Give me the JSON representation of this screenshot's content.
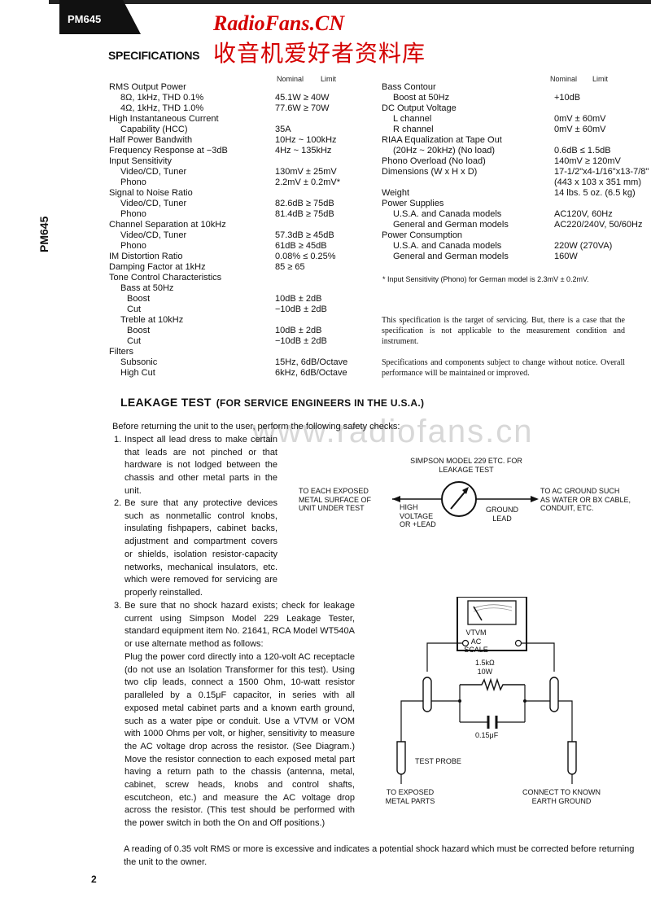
{
  "header": {
    "model_tab": "PM645",
    "watermark_en": "RadioFans.CN",
    "watermark_cn": "收音机爱好者资料库",
    "watermark_url": "www.radiofans.cn",
    "side_label": "PM645",
    "page_number": "2"
  },
  "specifications": {
    "title": "SPECIFICATIONS",
    "col_nominal": "Nominal",
    "col_limit": "Limit",
    "left_rows": [
      {
        "label": "RMS Output Power",
        "indent": 0,
        "value": ""
      },
      {
        "label": "8Ω, 1kHz, THD 0.1%",
        "indent": 1,
        "value": "45.1W ≥ 40W"
      },
      {
        "label": "4Ω, 1kHz, THD 1.0%",
        "indent": 1,
        "value": "77.6W ≥ 70W"
      },
      {
        "label": "High Instantaneous Current",
        "indent": 0,
        "value": ""
      },
      {
        "label": "Capability (HCC)",
        "indent": 1,
        "value": "35A"
      },
      {
        "label": "Half Power Bandwith",
        "indent": 0,
        "value": "10Hz ~ 100kHz"
      },
      {
        "label": "Frequency Response at −3dB",
        "indent": 0,
        "value": "4Hz ~ 135kHz"
      },
      {
        "label": "Input Sensitivity",
        "indent": 0,
        "value": ""
      },
      {
        "label": "Video/CD, Tuner",
        "indent": 1,
        "value": "130mV ± 25mV"
      },
      {
        "label": "Phono",
        "indent": 1,
        "value": "2.2mV ± 0.2mV*"
      },
      {
        "label": "Signal to Noise Ratio",
        "indent": 0,
        "value": ""
      },
      {
        "label": "Video/CD, Tuner",
        "indent": 1,
        "value": "82.6dB ≥ 75dB"
      },
      {
        "label": "Phono",
        "indent": 1,
        "value": "81.4dB ≥ 75dB"
      },
      {
        "label": "Channel Separation at 10kHz",
        "indent": 0,
        "value": ""
      },
      {
        "label": "Video/CD, Tuner",
        "indent": 1,
        "value": "57.3dB ≥ 45dB"
      },
      {
        "label": "Phono",
        "indent": 1,
        "value": "61dB ≥ 45dB"
      },
      {
        "label": "IM Distortion Ratio",
        "indent": 0,
        "value": "0.08% ≤ 0.25%"
      },
      {
        "label": "Damping Factor at 1kHz",
        "indent": 0,
        "value": "85 ≥ 65"
      },
      {
        "label": "Tone Control Characteristics",
        "indent": 0,
        "value": ""
      },
      {
        "label": "Bass at 50Hz",
        "indent": 1,
        "value": ""
      },
      {
        "label": "Boost",
        "indent": 2,
        "value": "10dB ± 2dB"
      },
      {
        "label": "Cut",
        "indent": 2,
        "value": "−10dB ± 2dB"
      },
      {
        "label": "Treble at 10kHz",
        "indent": 1,
        "value": ""
      },
      {
        "label": "Boost",
        "indent": 2,
        "value": "10dB ± 2dB"
      },
      {
        "label": "Cut",
        "indent": 2,
        "value": "−10dB ± 2dB"
      },
      {
        "label": "Filters",
        "indent": 0,
        "value": ""
      },
      {
        "label": "Subsonic",
        "indent": 1,
        "value": "15Hz, 6dB/Octave"
      },
      {
        "label": "High Cut",
        "indent": 1,
        "value": "6kHz, 6dB/Octave"
      }
    ],
    "right_rows": [
      {
        "label": "Bass Contour",
        "indent": 0,
        "value": ""
      },
      {
        "label": "Boost at 50Hz",
        "indent": 1,
        "value": "+10dB"
      },
      {
        "label": "DC Output Voltage",
        "indent": 0,
        "value": ""
      },
      {
        "label": "L channel",
        "indent": 1,
        "value": "0mV ± 60mV"
      },
      {
        "label": "R channel",
        "indent": 1,
        "value": "0mV ± 60mV"
      },
      {
        "label": "RIAA Equalization at Tape Out",
        "indent": 0,
        "value": ""
      },
      {
        "label": "(20Hz ~ 20kHz) (No load)",
        "indent": 1,
        "value": "0.6dB ≤ 1.5dB"
      },
      {
        "label": "Phono Overload (No load)",
        "indent": 0,
        "value": "140mV ≥ 120mV"
      },
      {
        "label": "Dimensions (W x H x D)",
        "indent": 0,
        "value": "17-1/2\"x4-1/16\"x13-7/8\""
      },
      {
        "label": "",
        "indent": 0,
        "value": "(443 x 103 x 351 mm)"
      },
      {
        "label": "Weight",
        "indent": 0,
        "value": "14 lbs. 5 oz. (6.5 kg)"
      },
      {
        "label": "Power Supplies",
        "indent": 0,
        "value": ""
      },
      {
        "label": "U.S.A. and Canada models",
        "indent": 1,
        "value": "AC120V, 60Hz"
      },
      {
        "label": "General and German models",
        "indent": 1,
        "value": "AC220/240V, 50/60Hz"
      },
      {
        "label": "Power Consumption",
        "indent": 0,
        "value": ""
      },
      {
        "label": "U.S.A. and Canada models",
        "indent": 1,
        "value": "220W (270VA)"
      },
      {
        "label": "General and German models",
        "indent": 1,
        "value": "160W"
      }
    ],
    "footnote": "* Input Sensitivity (Phono) for German model is 2.3mV ± 0.2mV.",
    "note1": "This specification is the target of servicing. But, there is a case that the specification is not applicable to the measurement condition and instrument.",
    "note2": "Specifications and components subject to change without notice. Overall performance will be maintained or improved."
  },
  "leakage": {
    "title": "LEAKAGE TEST",
    "subtitle": "(FOR SERVICE ENGINEERS IN THE U.S.A.)",
    "intro": "Before returning the unit to the user, perform the following safety checks:",
    "item1_num": "1.",
    "item1": "Inspect all lead dress to make certain that leads are not pinched or that hardware is not lodged between the chassis and other metal parts in the unit.",
    "item2_num": "2.",
    "item2": "Be sure that any protective devices such as nonmetallic control knobs, insulating fishpapers, cabinet backs, adjustment and compartment covers or shields, isolation resistor-capacity networks, mechanical insulators, etc. which were removed for servicing are properly reinstalled.",
    "item3_num": "3.",
    "item3a": "Be sure that no shock hazard exists; check for leakage current using Simpson Model 229 Leakage Tester, standard equipment item No. 21641, RCA Model WT540A or use alternate method as follows:",
    "item3b": "Plug the power cord directly into a 120-volt AC receptacle (do not use an Isolation Transformer for this test). Using two clip leads, connect a 1500 Ohm, 10-watt resistor paralleled by a 0.15μF capacitor, in series with all exposed metal cabinet parts and a known earth ground, such as a water pipe or conduit. Use a VTVM or VOM with 1000 Ohms per volt, or higher, sensitivity to measure the AC voltage drop across the resistor. (See Diagram.) Move the resistor connection to each exposed metal part having a return path to the chassis (antenna, metal, cabinet, screw heads, knobs and control shafts, escutcheon, etc.) and measure the AC voltage drop across the resistor. (This test should be performed with the power switch in both the On and Off positions.)",
    "conclusion": "A reading of 0.35 volt RMS or more is excessive and indicates a potential shock hazard which must be corrected before returning the unit to the owner.",
    "diagram1": {
      "title_l1": "SIMPSON MODEL 229 ETC. FOR",
      "title_l2": "LEAKAGE TEST",
      "left_l1": "TO EACH EXPOSED",
      "left_l2": "METAL SURFACE OF",
      "left_l3": "UNIT UNDER TEST",
      "hv_l1": "HIGH",
      "hv_l2": "VOLTAGE",
      "hv_l3": "OR +LEAD",
      "gnd_l1": "GROUND",
      "gnd_l2": "LEAD",
      "right_l1": "TO AC GROUND SUCH",
      "right_l2": "AS WATER OR BX CABLE,",
      "right_l3": "CONDUIT, ETC."
    },
    "diagram2": {
      "meter_l1": "VTVM",
      "meter_l2": "AC SCALE",
      "resistor_l1": "1.5kΩ",
      "resistor_l2": "10W",
      "capacitor": "0.15μF",
      "probe": "TEST PROBE",
      "left_l1": "TO EXPOSED",
      "left_l2": "METAL PARTS",
      "right_l1": "CONNECT TO KNOWN",
      "right_l2": "EARTH GROUND"
    }
  }
}
